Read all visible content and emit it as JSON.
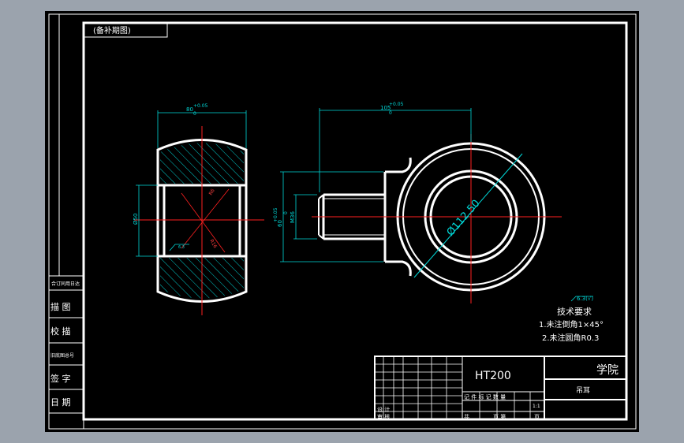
{
  "colors": {
    "background_outer": "#9ba3ad",
    "paper": "#000000",
    "frame": "#ffffff",
    "centerline": "#ff2020",
    "dimension": "#00d8d8",
    "hatch": "#00c8c8",
    "text": "#ffffff"
  },
  "drawing": {
    "corner_tag": "(备补期图)",
    "left_block": {
      "header": "合订同用日达",
      "row1": "描 图",
      "row2": "校 描",
      "row3": "旧底图总号",
      "row4": "签 字",
      "row5": "日 期"
    },
    "dimensions": {
      "top_width": "80",
      "top_tol_upper": "+0.05",
      "top_tol_lower": "0",
      "side_width": "105",
      "side_tol_upper": "+0.05",
      "side_tol_lower": "0",
      "bore_dia": "Ø50",
      "thread": "M36",
      "height": "60",
      "height_tol_upper": "+0.05",
      "height_tol_lower": "0",
      "ring_dia": "Ø112.50",
      "small_r1": "R6",
      "small_r2": "R16",
      "roughness_left": "6.3",
      "roughness_top": "6.3(√)"
    },
    "notes": {
      "title": "技术要求",
      "line1": "1.未注倒角1×45°",
      "line2": "2.未注圆角R0.3"
    },
    "title_block": {
      "material": "HT200",
      "school": "学院",
      "part_name": "吊耳",
      "row_labels": "记 件 标 记 数 量",
      "scale": "1:1",
      "designer": "设 计",
      "approve": "审 核",
      "total": "共",
      "sheet": "页 第",
      "page": "页"
    }
  }
}
